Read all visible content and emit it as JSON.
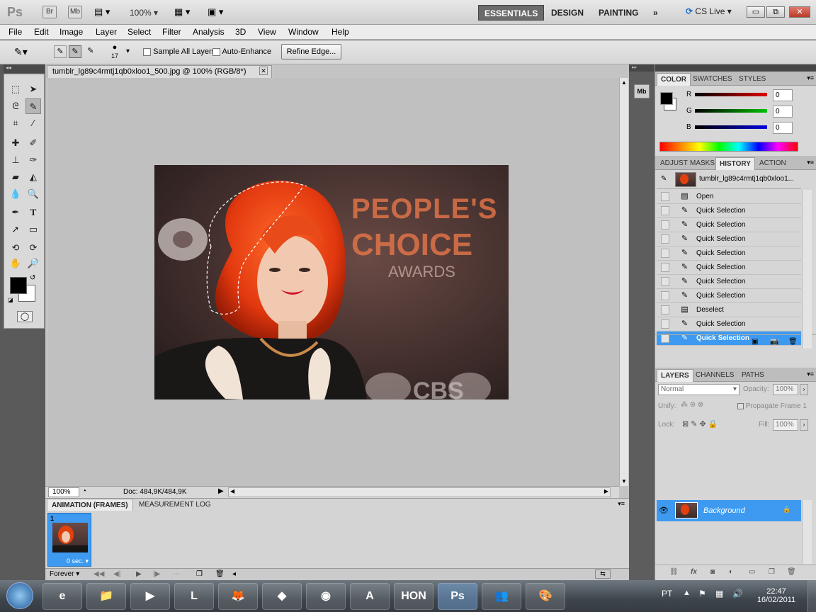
{
  "appbar": {
    "logo": "Ps",
    "bridge": "Br",
    "minibridge": "Mb",
    "zoom": "100%",
    "workspaces": [
      "ESSENTIALS",
      "DESIGN",
      "PAINTING"
    ],
    "more": "»",
    "cslive": "CS Live",
    "win_min": "▭",
    "win_restore": "⧉",
    "win_close": "✕"
  },
  "menu": [
    "File",
    "Edit",
    "Image",
    "Layer",
    "Select",
    "Filter",
    "Analysis",
    "3D",
    "View",
    "Window",
    "Help"
  ],
  "options": {
    "brush_size": "17",
    "sample_all_layers": "Sample All Layers",
    "auto_enhance": "Auto-Enhance",
    "refine_edge": "Refine Edge..."
  },
  "document": {
    "tab_title": "tumblr_lg89c4rmtj1qb0xloo1_500.jpg @ 100% (RGB/8*)",
    "tab_close": "✕",
    "zoom": "100%",
    "doc_info": "Doc: 484,9K/484,9K",
    "photo_text_1": "PEOPLE'S",
    "photo_text_2": "CHOICE",
    "photo_text_3": "AWARDS",
    "photo_text_4": "CBS"
  },
  "animation": {
    "tabs": [
      "ANIMATION (FRAMES)",
      "MEASUREMENT LOG"
    ],
    "frame_number": "1",
    "frame_delay": "0 sec.",
    "loop": "Forever"
  },
  "color_panel": {
    "tabs": [
      "COLOR",
      "SWATCHES",
      "STYLES"
    ],
    "channels": [
      {
        "label": "R",
        "value": "0",
        "color": "#e00000"
      },
      {
        "label": "G",
        "value": "0",
        "color": "#00c000"
      },
      {
        "label": "B",
        "value": "0",
        "color": "#0000e0"
      }
    ]
  },
  "history_panel": {
    "tabs": [
      "ADJUST",
      "MASKS",
      "HISTORY",
      "ACTION"
    ],
    "snapshot": "tumblr_lg89c4rmtj1qb0xloo1...",
    "items": [
      {
        "label": "Open",
        "icon": "doc-icon"
      },
      {
        "label": "Quick Selection",
        "icon": "brush-icon"
      },
      {
        "label": "Quick Selection",
        "icon": "brush-icon"
      },
      {
        "label": "Quick Selection",
        "icon": "brush-icon"
      },
      {
        "label": "Quick Selection",
        "icon": "brush-icon"
      },
      {
        "label": "Quick Selection",
        "icon": "brush-icon"
      },
      {
        "label": "Quick Selection",
        "icon": "brush-icon"
      },
      {
        "label": "Quick Selection",
        "icon": "brush-icon"
      },
      {
        "label": "Deselect",
        "icon": "doc-icon"
      },
      {
        "label": "Quick Selection",
        "icon": "brush-icon"
      },
      {
        "label": "Quick Selection",
        "icon": "brush-icon"
      }
    ],
    "selected_index": 10
  },
  "layers_panel": {
    "tabs": [
      "LAYERS",
      "CHANNELS",
      "PATHS"
    ],
    "blend_mode": "Normal",
    "opacity_label": "Opacity:",
    "opacity": "100%",
    "unify_label": "Unify:",
    "propagate": "Propagate Frame 1",
    "lock_label": "Lock:",
    "fill_label": "Fill:",
    "fill": "100%",
    "layer_name": "Background"
  },
  "taskbar": {
    "lang": "PT",
    "time": "22:47",
    "date": "16/02/2011",
    "apps": [
      "e",
      "📁",
      "▶",
      "L",
      "🦊",
      "◆",
      "◉",
      "A",
      "HON",
      "Ps",
      "👥",
      "🎨"
    ]
  },
  "colors": {
    "selection_blue": "#3d9af0",
    "taskbar": "#3e464d"
  }
}
